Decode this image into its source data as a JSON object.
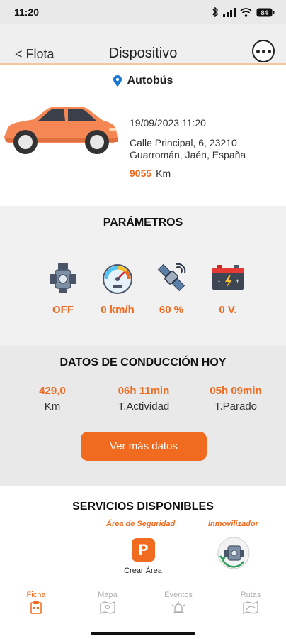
{
  "status_bar": {
    "time": "11:20",
    "battery": "84"
  },
  "header": {
    "back_label": "< Flota",
    "title": "Dispositivo"
  },
  "vehicle": {
    "name": "Autobús",
    "datetime": "19/09/2023 11:20",
    "address_line1": "Calle Principal, 6, 23210",
    "address_line2": "Guarromán, Jaén, España",
    "km_value": "9055",
    "km_unit": "Km"
  },
  "parameters": {
    "title": "PARÁMETROS",
    "items": [
      {
        "icon": "engine-icon",
        "value": "OFF"
      },
      {
        "icon": "speedometer-icon",
        "value": "0 km/h"
      },
      {
        "icon": "satellite-icon",
        "value": "60 %"
      },
      {
        "icon": "battery-icon",
        "value": "0 V."
      }
    ]
  },
  "driving": {
    "title": "DATOS DE CONDUCCIÓN HOY",
    "stats": [
      {
        "value": "429,0",
        "label": "Km"
      },
      {
        "value": "06h 11min",
        "label": "T.Actividad"
      },
      {
        "value": "05h 09min",
        "label": "T.Parado"
      }
    ],
    "more_button": "Ver más datos"
  },
  "services": {
    "title": "SERVICIOS DISPONIBLES",
    "security_area": {
      "label": "Área de Seguridad",
      "icon_letter": "P",
      "caption": "Crear Área"
    },
    "immobilizer": {
      "label": "Inmovilizador"
    }
  },
  "bottom_nav": {
    "items": [
      {
        "label": "Ficha",
        "active": true
      },
      {
        "label": "Mapa",
        "active": false
      },
      {
        "label": "Eventos",
        "active": false
      },
      {
        "label": "Rutas",
        "active": false
      }
    ]
  },
  "colors": {
    "accent": "#f06a1f",
    "car": "#f58755",
    "header_border": "#f6c59c"
  }
}
